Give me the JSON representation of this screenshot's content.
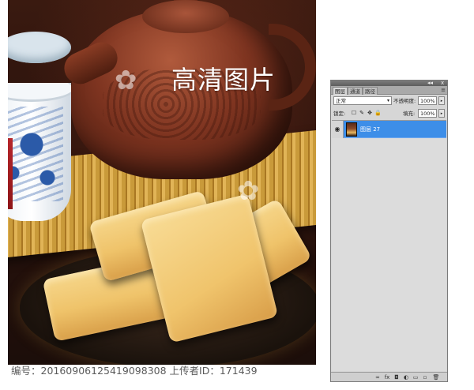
{
  "photo": {
    "overlay_title": "高清图片",
    "watermark_glyph": "✿"
  },
  "caption": {
    "text": "编号：20160906125419098308 上传者ID：171439"
  },
  "layers_panel": {
    "window_controls": {
      "collapse": "◂◂",
      "close": "x"
    },
    "tabs": [
      {
        "label": "图层",
        "active": true
      },
      {
        "label": "通道",
        "active": false
      },
      {
        "label": "路径",
        "active": false
      }
    ],
    "menu_icon": "≡",
    "blend_mode": "正常",
    "opacity_label": "不透明度:",
    "opacity_value": "100%",
    "lock_label": "锁定:",
    "fill_label": "填充:",
    "fill_value": "100%",
    "lock_icons": [
      "☐",
      "✎",
      "✥",
      "🔒"
    ],
    "layers": [
      {
        "name": "图层 27",
        "visible": true,
        "selected": true
      }
    ],
    "bottom_icons": [
      "∞",
      "fx",
      "◘",
      "◐",
      "▭",
      "▫",
      "🗑"
    ],
    "accent_color": "#3d8ee8"
  }
}
